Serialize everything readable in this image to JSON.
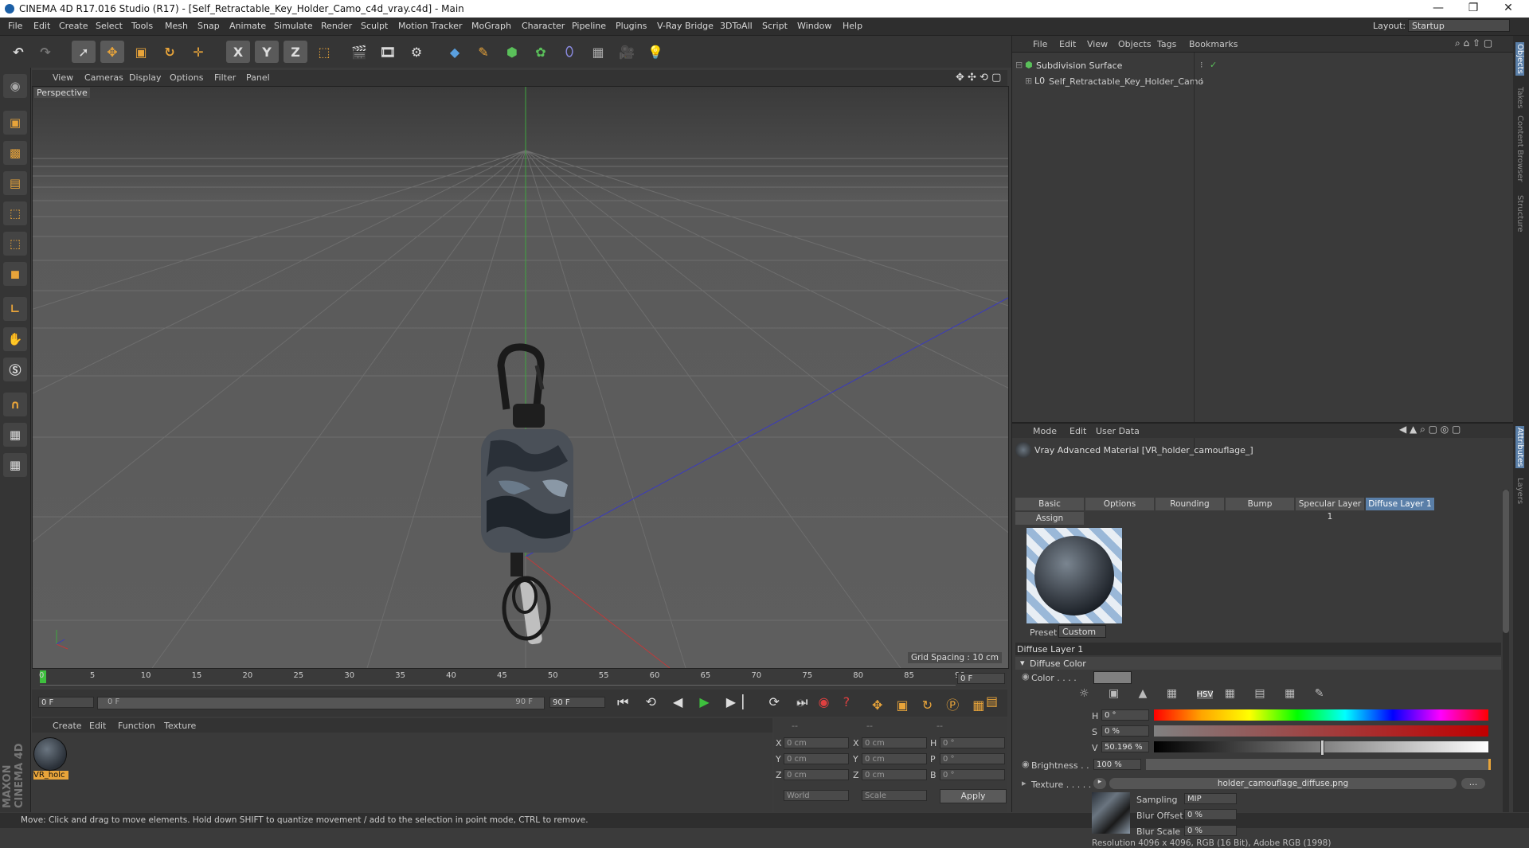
{
  "window": {
    "title": "CINEMA 4D R17.016 Studio (R17) - [Self_Retractable_Key_Holder_Camo_c4d_vray.c4d] - Main",
    "controls": [
      "—",
      "❐",
      "✕"
    ]
  },
  "menubar": {
    "items": [
      "File",
      "Edit",
      "Create",
      "Select",
      "Tools",
      "Mesh",
      "Snap",
      "Animate",
      "Simulate",
      "Render",
      "Sculpt",
      "Motion Tracker",
      "MoGraph",
      "Character",
      "Pipeline",
      "Plugins",
      "V-Ray Bridge",
      "3DToAll",
      "Script",
      "Window",
      "Help"
    ],
    "layout_label": "Layout:",
    "layout_value": "Startup"
  },
  "toolbar": {
    "axis_x": "X",
    "axis_y": "Y",
    "axis_z": "Z"
  },
  "viewport": {
    "menu": [
      "View",
      "Cameras",
      "Display",
      "Options",
      "Filter",
      "Panel"
    ],
    "label": "Perspective",
    "grid_spacing": "Grid Spacing : 10 cm"
  },
  "timeline": {
    "ticks": [
      "0",
      "5",
      "10",
      "15",
      "20",
      "25",
      "30",
      "35",
      "40",
      "45",
      "50",
      "55",
      "60",
      "65",
      "70",
      "75",
      "80",
      "85",
      "90"
    ],
    "current_frame": "0 F",
    "start_field": "0 F",
    "range_start": "0 F",
    "range_end": "90 F",
    "end_field": "90 F"
  },
  "material_manager": {
    "menu": [
      "Create",
      "Edit",
      "Function",
      "Texture"
    ],
    "material_label": "VR_holc"
  },
  "coordinates": {
    "header": [
      "--",
      "--",
      "--"
    ],
    "rows": [
      {
        "a": "X",
        "av": "0 cm",
        "b": "X",
        "bv": "0 cm",
        "c": "H",
        "cv": "0 °"
      },
      {
        "a": "Y",
        "av": "0 cm",
        "b": "Y",
        "bv": "0 cm",
        "c": "P",
        "cv": "0 °"
      },
      {
        "a": "Z",
        "av": "0 cm",
        "b": "Z",
        "bv": "0 cm",
        "c": "B",
        "cv": "0 °"
      }
    ],
    "world": "World",
    "scale": "Scale",
    "apply": "Apply"
  },
  "status": "Move: Click and drag to move elements. Hold down SHIFT to quantize movement / add to the selection in point mode, CTRL to remove.",
  "objects_panel": {
    "menu": [
      "File",
      "Edit",
      "View",
      "Objects",
      "Tags",
      "Bookmarks"
    ],
    "items": [
      {
        "name": "Subdivision Surface"
      },
      {
        "name": "Self_Retractable_Key_Holder_Camo"
      }
    ]
  },
  "side_tabs": {
    "top": [
      "Objects",
      "Takes",
      "Content Browser",
      "Structure"
    ],
    "bottom": [
      "Attributes",
      "Layers"
    ]
  },
  "attributes": {
    "menu": [
      "Mode",
      "Edit",
      "User Data"
    ],
    "title": "Vray Advanced Material [VR_holder_camouflage_]",
    "tabs": [
      "Basic",
      "Options",
      "Rounding",
      "Bump",
      "Specular Layer 1",
      "Diffuse Layer 1"
    ],
    "tab_active": "Diffuse Layer 1",
    "assign": "Assign",
    "preset_label": "Preset",
    "preset_value": "Custom",
    "section": "Diffuse Layer 1",
    "group": "Diffuse Color",
    "color_label": "Color . . . .",
    "hsv": [
      {
        "label": "H",
        "value": "0 °"
      },
      {
        "label": "S",
        "value": "0 %"
      },
      {
        "label": "V",
        "value": "50.196 %"
      }
    ],
    "v_level": 0.50196,
    "brightness_label": "Brightness . .",
    "brightness_value": "100 %",
    "texture_label": "Texture . . . . .",
    "texture_file": "holder_camouflage_diffuse.png",
    "texture_btn": "...",
    "sampling_label": "Sampling",
    "sampling_value": "MIP",
    "blur_offset_label": "Blur Offset",
    "blur_offset_value": "0 %",
    "blur_scale_label": "Blur Scale",
    "blur_scale_value": "0 %",
    "resolution": "Resolution 4096 x 4096, RGB (16 Bit), Adobe RGB (1998)"
  },
  "colors": {
    "accent": "#5a7fa8",
    "orange": "#e8a43a"
  }
}
